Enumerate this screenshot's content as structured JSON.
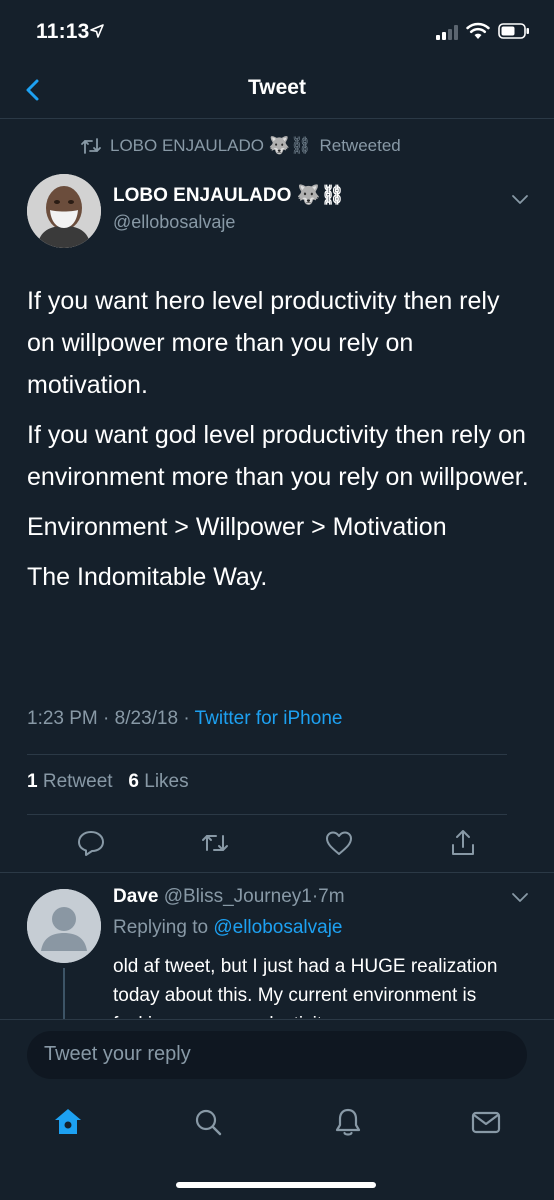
{
  "status_bar": {
    "time": "11:13"
  },
  "nav": {
    "title": "Tweet"
  },
  "retweet": {
    "retweeter": "LOBO ENJAULADO 🐺⛓",
    "label": "Retweeted"
  },
  "tweet": {
    "author_name": "LOBO ENJAULADO 🐺⛓",
    "author_handle": "@ellobosalvaje",
    "paragraphs": [
      "If you want hero level productivity then rely on willpower more than you rely on motivation.",
      "If you want god level productivity then rely on environment more than you rely on willpower.",
      "Environment > Willpower > Motivation",
      "The Indomitable Way."
    ],
    "time": "1:23 PM",
    "date": "8/23/18",
    "source": "Twitter for iPhone",
    "retweet_count": "1",
    "retweet_label": "Retweet",
    "like_count": "6",
    "like_label": "Likes"
  },
  "reply": {
    "name": "Dave",
    "handle": "@Bliss_Journey1",
    "age": "7m",
    "replying_label": "Replying to",
    "replying_to": "@ellobosalvaje",
    "text": "old af tweet, but I just had a HUGE realization today about this. My current environment is fucking up my productivity"
  },
  "composer": {
    "placeholder": "Tweet your reply"
  },
  "colors": {
    "background": "#15202b",
    "accent": "#1da1f2",
    "muted": "#8899a6",
    "divider": "#2b3946"
  },
  "icons": [
    "back-chevron-icon",
    "retweet-icon",
    "chevron-down-icon",
    "reply-icon",
    "like-icon",
    "share-icon",
    "home-icon",
    "search-icon",
    "notifications-icon",
    "messages-icon"
  ]
}
